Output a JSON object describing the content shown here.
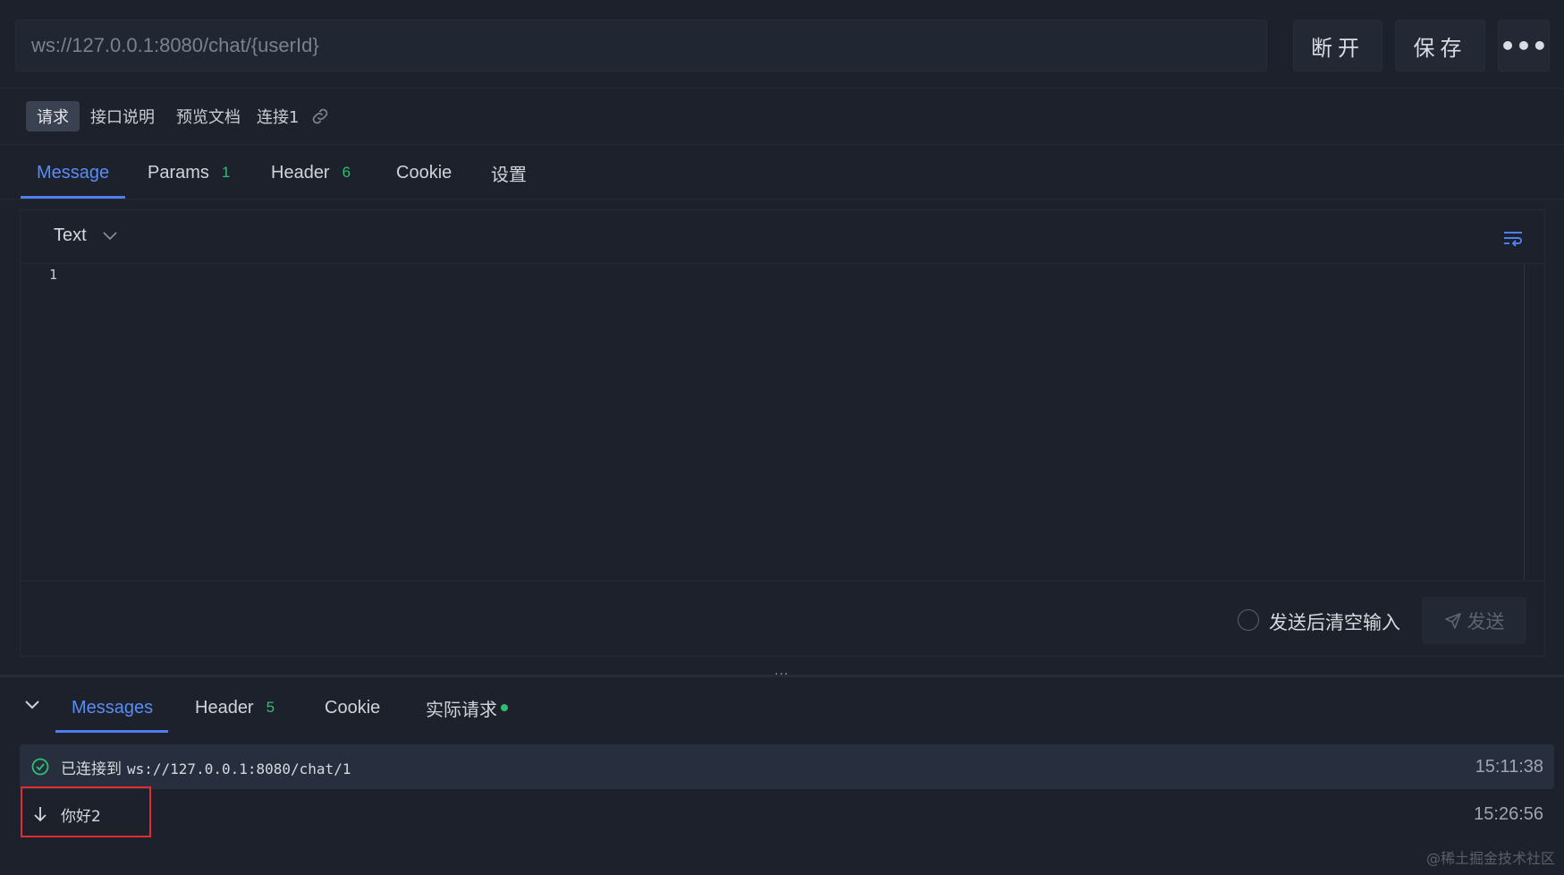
{
  "toolbar": {
    "url_value": "ws://127.0.0.1:8080/chat/{userId}",
    "disconnect_label": "断开",
    "save_label": "保存",
    "more_label": "•••"
  },
  "subtabs": [
    {
      "label": "请求",
      "active": true
    },
    {
      "label": "接口说明",
      "active": false
    },
    {
      "label": "预览文档",
      "active": false
    },
    {
      "label": "连接1",
      "active": false
    }
  ],
  "request_tabs": [
    {
      "label": "Message",
      "count": "",
      "active": true
    },
    {
      "label": "Params",
      "count": "1",
      "active": false
    },
    {
      "label": "Header",
      "count": "6",
      "active": false
    },
    {
      "label": "Cookie",
      "count": "",
      "active": false
    },
    {
      "label": "设置",
      "count": "",
      "active": false
    }
  ],
  "editor": {
    "format": "Text",
    "line_number": "1",
    "content": ""
  },
  "send_options": {
    "clear_after_send_label": "发送后清空输入",
    "clear_after_send_checked": false,
    "send_label": "发送"
  },
  "splitter": {
    "handle": "···"
  },
  "response_tabs": [
    {
      "label": "Messages",
      "count": "",
      "active": true
    },
    {
      "label": "Header",
      "count": "5",
      "active": false
    },
    {
      "label": "Cookie",
      "count": "",
      "active": false
    },
    {
      "label": "实际请求",
      "count": "",
      "active": false,
      "status_dot": true
    }
  ],
  "messages": [
    {
      "type": "connected",
      "icon": "check-circle-icon",
      "prefix": "已连接到",
      "text": "ws://127.0.0.1:8080/chat/1",
      "time": "15:11:38"
    },
    {
      "type": "received",
      "icon": "arrow-down-icon",
      "prefix": "",
      "text": "你好2",
      "time": "15:26:56"
    }
  ],
  "watermark": "@稀土掘金技术社区",
  "colors": {
    "background": "#1c212b",
    "accent": "#5b8cf5",
    "count_green": "#2fbf71",
    "highlight_red": "#e02d2d"
  }
}
